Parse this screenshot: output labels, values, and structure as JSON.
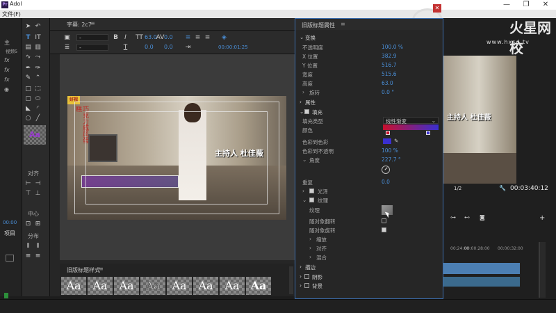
{
  "app": {
    "title": "Adol",
    "menu_file": "文件(F)"
  },
  "left_strip": {
    "labels": [
      "主",
      "视频5",
      "对齐",
      "中心",
      "分布",
      "项目"
    ],
    "timecode": "00:00"
  },
  "editor": {
    "title": "字幕: 2c7",
    "font_value": "-",
    "font_style": "-",
    "size_value": "63.0",
    "kerning_value": "0.0",
    "leading_value": "0.0",
    "tracking_value": "0.0",
    "timecode": "00:00:01:25",
    "video_text_host": "主持人  杜佳薇",
    "video_side_text": "巧克力威风蛋糕",
    "video_logo": "好视",
    "styles_title": "旧版标题样式",
    "style_samples": [
      "Aa",
      "Aa",
      "Aa",
      "Aa",
      "Aa",
      "Aa",
      "Aa",
      "Aa"
    ]
  },
  "properties": {
    "title": "旧版标题属性",
    "sections": {
      "transform": "变换",
      "properties": "属性",
      "fill": "填充",
      "stroke": "描边",
      "shadow": "阴影",
      "background": "背景"
    },
    "transform_rows": [
      {
        "label": "不透明度",
        "value": "100.0 %"
      },
      {
        "label": "X 位置",
        "value": "382.9"
      },
      {
        "label": "Y 位置",
        "value": "516.7"
      },
      {
        "label": "宽度",
        "value": "515.6"
      },
      {
        "label": "高度",
        "value": "63.0"
      },
      {
        "label": "旋转",
        "value": "0.0 °"
      }
    ],
    "fill_rows": [
      {
        "label": "填充类型",
        "value": "线性渐变"
      },
      {
        "label": "颜色",
        "value": ""
      },
      {
        "label": "色彩到色彩",
        "value": ""
      },
      {
        "label": "色彩到不透明",
        "value": "100 %"
      },
      {
        "label": "角度",
        "value": "227.7 °"
      },
      {
        "label": "重复",
        "value": "0.0"
      }
    ],
    "sheen_label": "光泽",
    "texture_label": "纹理",
    "texture_sub_label": "纹理",
    "flip_with_object": "随对象翻转",
    "rotate_with_object": "随对象旋转",
    "scale_label": "缩放",
    "align_label": "对齐",
    "blend_label": "混合"
  },
  "right": {
    "watermark_brand": "火星网校",
    "watermark_url": "www.hxsd.tv",
    "video_text": "主持人  杜佳薇",
    "fraction": "1/2",
    "timecode": "00:03:40:12",
    "ruler_times": [
      "00:24:00",
      "00:00:28:00",
      "00:00:32:00"
    ]
  },
  "colors": {
    "accent": "#4a8fd8",
    "gradient_start": "#c8102e",
    "gradient_end": "#3a2fd0"
  }
}
